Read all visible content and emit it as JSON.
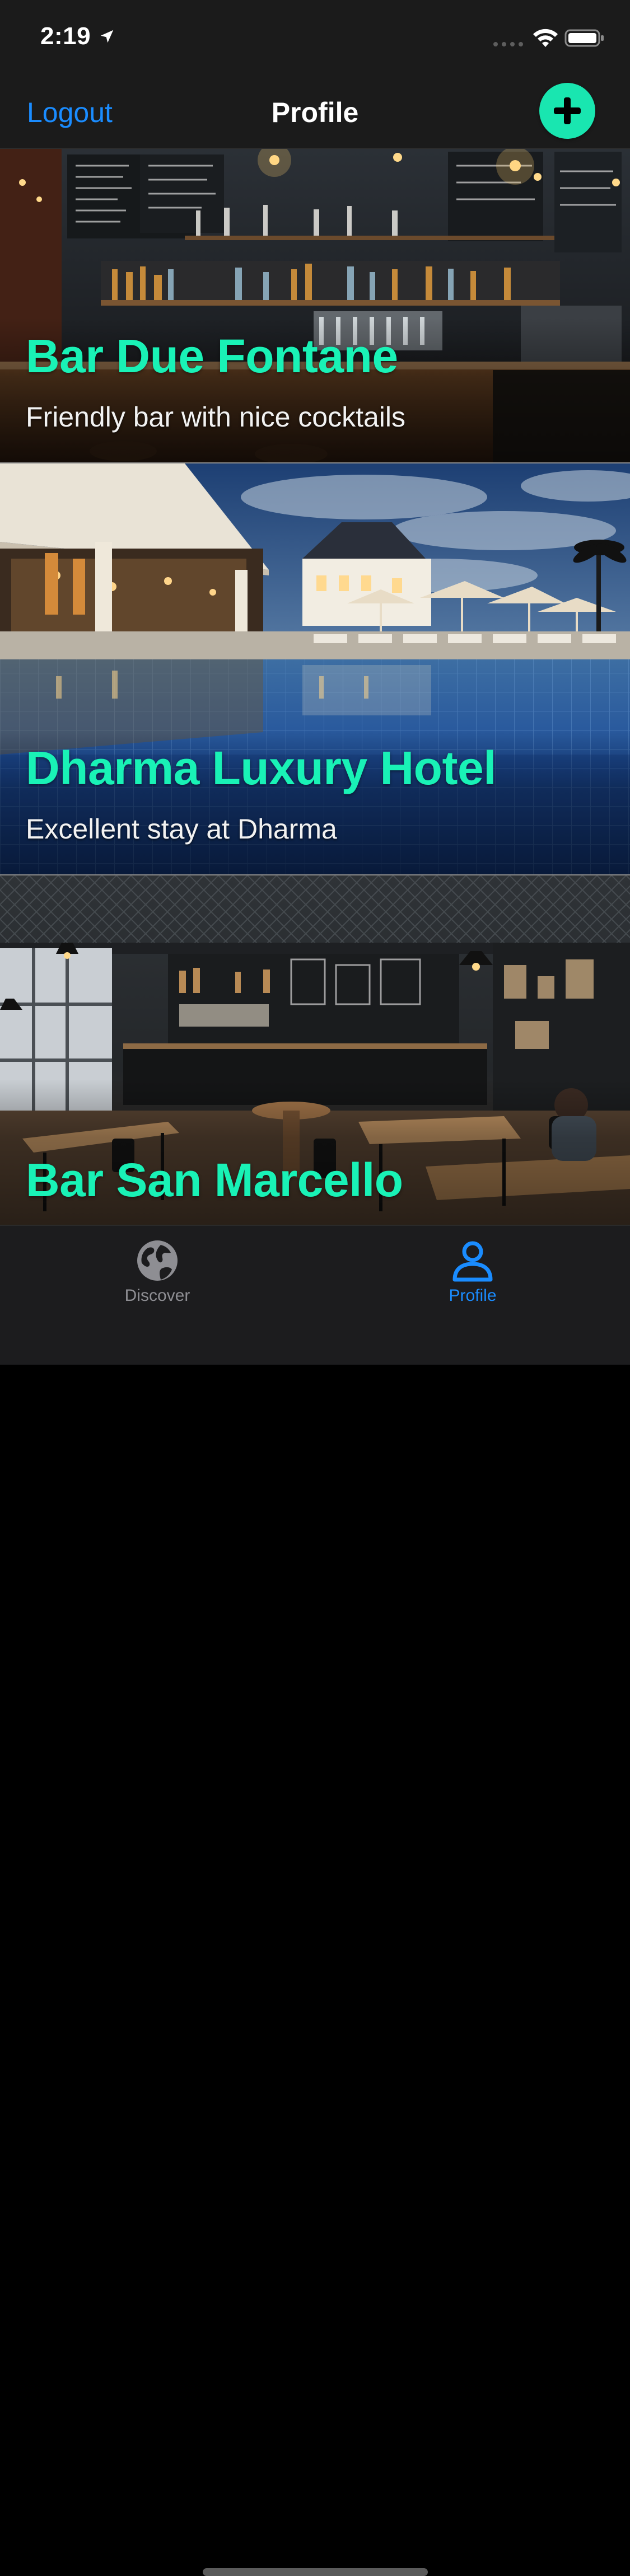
{
  "status_bar": {
    "time": "2:19",
    "icons": [
      "location-arrow-icon",
      "signal-dots-icon",
      "wifi-icon",
      "battery-icon"
    ]
  },
  "nav": {
    "logout_label": "Logout",
    "title": "Profile",
    "add_icon": "plus-circle-icon"
  },
  "colors": {
    "accent_blue": "#1a8cff",
    "accent_mint": "#19f2b6",
    "background": "#1b1b1b",
    "tab_inactive": "#8e8e93"
  },
  "places": [
    {
      "title": "Bar Due Fontane",
      "subtitle": "Friendly bar with nice cocktails",
      "image": "bar-interior-photo"
    },
    {
      "title": "Dharma Luxury Hotel",
      "subtitle": "Excellent stay at Dharma",
      "image": "hotel-pool-photo"
    },
    {
      "title": "Bar San Marcello",
      "subtitle": "",
      "image": "cafe-interior-photo"
    }
  ],
  "tab_bar": {
    "tabs": [
      {
        "label": "Discover",
        "icon": "globe-icon",
        "selected": false
      },
      {
        "label": "Profile",
        "icon": "person-icon",
        "selected": true
      }
    ]
  }
}
